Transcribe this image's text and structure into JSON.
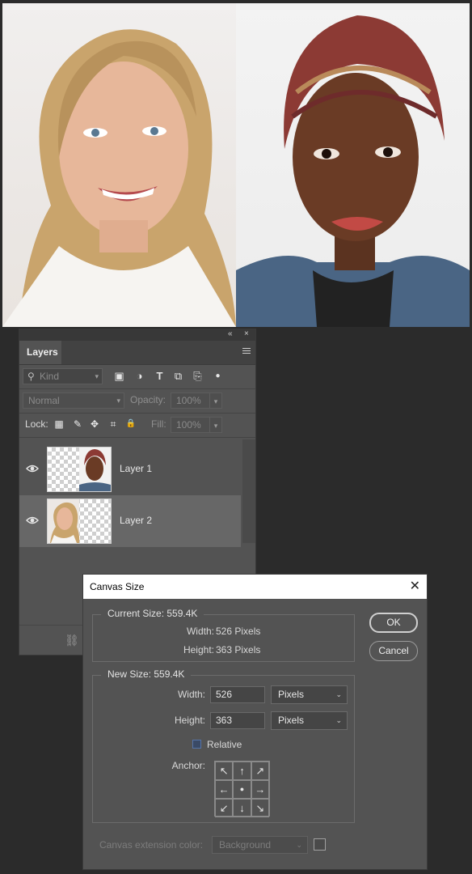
{
  "colors": {
    "workspace": "#2b2b2b",
    "panel": "#535353",
    "selected_row": "#676767",
    "checkbox_accent": "#3a4a66"
  },
  "canvas": {
    "left_photo": "woman-smiling-blonde",
    "right_photo": "woman-headwrap"
  },
  "layers_panel": {
    "collapse_label": "«",
    "close_label": "×",
    "tab_label": "Layers",
    "filter": {
      "placeholder": "Kind",
      "icon": "search-icon",
      "type_icons": [
        "image-filter-icon",
        "adjustment-filter-icon",
        "type-filter-icon",
        "shape-filter-icon",
        "smart-object-filter-icon",
        "filter-toggle-icon"
      ],
      "type_glyphs": [
        "▣",
        "◑",
        "T",
        "⧉",
        "⎘",
        "●"
      ]
    },
    "blend_mode": "Normal",
    "opacity_label": "Opacity:",
    "opacity_value": "100%",
    "lock_label": "Lock:",
    "lock_icons": [
      "lock-transparent-pixels-icon",
      "lock-image-pixels-icon",
      "lock-position-icon",
      "lock-artboard-icon",
      "lock-all-icon"
    ],
    "lock_glyphs": [
      "▦",
      "✎",
      "✥",
      "⌗",
      "🔒"
    ],
    "fill_label": "Fill:",
    "fill_value": "100%",
    "layers": [
      {
        "name": "Layer 1",
        "visible": true,
        "selected": false
      },
      {
        "name": "Layer 2",
        "visible": true,
        "selected": true
      }
    ],
    "footer_icon": "link-icon",
    "footer_glyph": "⛓"
  },
  "canvas_size_dialog": {
    "title": "Canvas Size",
    "close_glyph": "✕",
    "current_size": {
      "title": "Current Size: 559.4K",
      "width_label": "Width:",
      "width_value": "526 Pixels",
      "height_label": "Height:",
      "height_value": "363 Pixels"
    },
    "new_size": {
      "title": "New Size: 559.4K",
      "width_label": "Width:",
      "width_value": "526",
      "width_unit": "Pixels",
      "height_label": "Height:",
      "height_value": "363",
      "height_unit": "Pixels"
    },
    "relative_label": "Relative",
    "relative_checked": false,
    "anchor_label": "Anchor:",
    "anchor_glyphs": [
      "↖",
      "↑",
      "↗",
      "←",
      "●",
      "→",
      "↙",
      "↓",
      "↘"
    ],
    "extension_color_label": "Canvas extension color:",
    "extension_color_value": "Background",
    "ok_label": "OK",
    "cancel_label": "Cancel"
  }
}
